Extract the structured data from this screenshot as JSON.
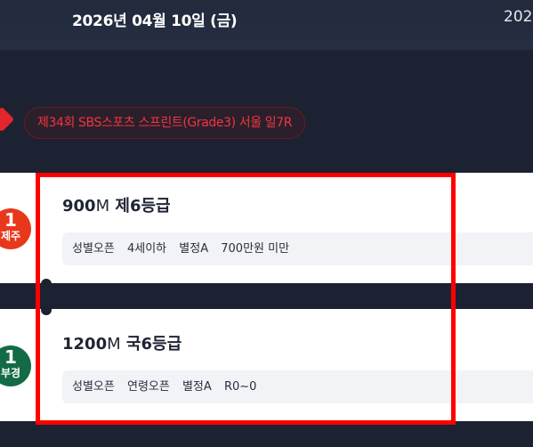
{
  "header": {
    "date": "2026년 04월 10일 (금)",
    "date_right": "2026"
  },
  "race": {
    "title": "제34회 SBS스포츠 스프린트(Grade3) 서울 일7R"
  },
  "cards": [
    {
      "badge_num": "1",
      "badge_loc": "제주",
      "distance": "900",
      "unit": "M",
      "grade": "제6등급",
      "conditions": [
        "성별오픈",
        "4세이하",
        "별정A",
        "700만원 미만"
      ]
    },
    {
      "badge_num": "1",
      "badge_loc": "부경",
      "distance": "1200",
      "unit": "M",
      "grade": "국6등급",
      "conditions": [
        "성별오픈",
        "연령오픈",
        "별정A",
        "R0~0"
      ]
    }
  ],
  "colors": {
    "background": "#1c2231",
    "race_red": "#e3262c",
    "jeju_badge": "#e8381c",
    "bukyung_badge": "#136b45",
    "highlight": "#ff0000"
  }
}
